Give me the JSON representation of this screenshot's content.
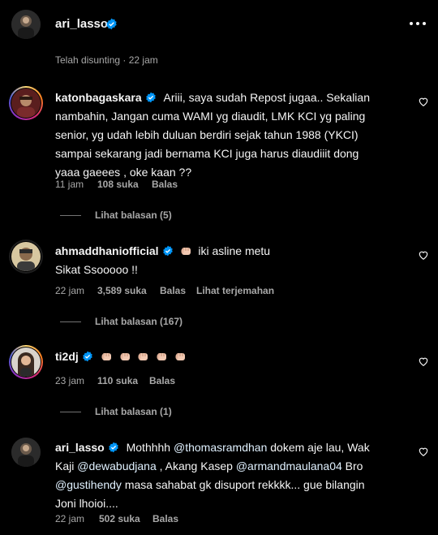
{
  "header": {
    "username": "ari_lasso",
    "edited": "Telah disunting · 22 jam",
    "more_icon": "more-horizontal-icon"
  },
  "comments": [
    {
      "username": "katonbagaskara",
      "text": "Ariii, saya sudah Repost jugaa.. Sekalian nambahin, Jangan cuma WAMI yg diaudit, LMK KCI yg paling senior, yg udah lebih duluan berdiri sejak tahun 1988 (YKCI) sampai sekarang jadi bernama KCI juga harus diaudiiit dong yaaa gaeees , oke kaan ??",
      "lines": [
        "Ariii, saya sudah Repost jugaa.. Sekalian",
        "nambahin, Jangan cuma WAMI yg diaudit, LMK KCI yg paling",
        "senior, yg udah lebih duluan berdiri sejak tahun 1988 (YKCI)",
        "sampai sekarang jadi bernama KCI juga harus diaudiiit dong",
        "yaaa gaeees , oke kaan ??"
      ],
      "time": "11 jam",
      "likes": "108 suka",
      "reply": "Balas",
      "view_replies": "Lihat balasan (5)"
    },
    {
      "username": "ahmaddhaniofficial",
      "first_line": "iki asline metu",
      "second_line": "Sikat Ssooooo !!",
      "time": "22 jam",
      "likes": "3,589 suka",
      "reply": "Balas",
      "translate": "Lihat terjemahan",
      "view_replies": "Lihat balasan (167)"
    },
    {
      "username": "ti2dj",
      "emoji_count": 5,
      "time": "23 jam",
      "likes": "110 suka",
      "reply": "Balas",
      "view_replies": "Lihat balasan (1)"
    },
    {
      "username": "ari_lasso",
      "segments_line1": [
        "Mothhhh ",
        "@thomasramdhan",
        " dokem aje lau, Wak"
      ],
      "segments_line2": [
        "Kaji ",
        "@dewabudjana",
        " , Akang Kasep ",
        "@armandmaulana04",
        " Bro"
      ],
      "segments_line3": [
        "@gustihendy",
        " masa sahabat gk disuport rekkkk... gue bilangin"
      ],
      "line4": "Joni lhoioi....",
      "time": "22 jam",
      "likes": "502 suka",
      "reply": "Balas"
    }
  ],
  "colors": {
    "background": "#000000",
    "text": "#f5f5f5",
    "secondary": "#a8a8a8",
    "verified": "#0095f6",
    "mention": "#e0f1ff"
  }
}
